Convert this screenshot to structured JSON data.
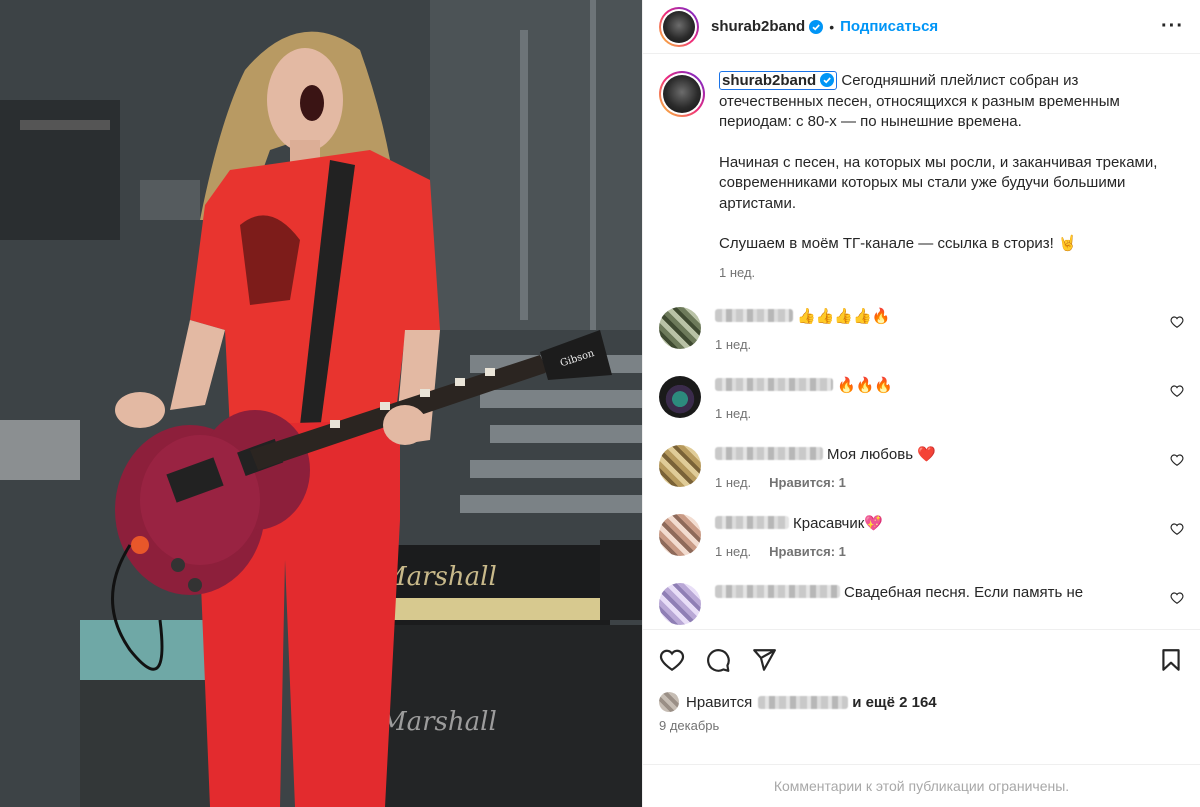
{
  "post": {
    "username": "shurab2band",
    "follow_label": "Подписаться",
    "more_label": "···",
    "caption_paragraphs": [
      "Сегодняшний плейлист собран из отечественных песен, относящихся к разным временным периодам: с 80-х — по нынешние времена.",
      "Начиная с песен, на которых мы росли, и заканчивая треками, современниками которых мы стали уже будучи большими артистами.",
      "Слушаем в моём ТГ-канале — ссылка в сториз! 🤘"
    ],
    "caption_time": "1 нед."
  },
  "comments": [
    {
      "text": "👍👍👍👍🔥",
      "time": "1 нед.",
      "likes_label": ""
    },
    {
      "text": "🔥🔥🔥",
      "time": "1 нед.",
      "likes_label": ""
    },
    {
      "text": "Моя любовь ❤️",
      "time": "1 нед.",
      "likes_label": "Нравится: 1"
    },
    {
      "text": "Красавчик💖",
      "time": "1 нед.",
      "likes_label": "Нравится: 1"
    },
    {
      "text": "Свадебная песня. Если память не",
      "time": "",
      "likes_label": ""
    }
  ],
  "footer": {
    "likes_prefix": "Нравится",
    "likes_suffix": "и ещё 2 164",
    "date": "9 декабрь",
    "comments_limited": "Комментарии к этой публикации ограничены."
  },
  "colors": {
    "accent": "#0095f6",
    "verified": "#0095f6",
    "muted": "#737373",
    "shirt": "#e8342f",
    "guitar": "#8d1f3b"
  },
  "icons": [
    "verified-icon",
    "more-icon",
    "heart-icon",
    "comment-icon",
    "share-icon",
    "bookmark-icon"
  ]
}
